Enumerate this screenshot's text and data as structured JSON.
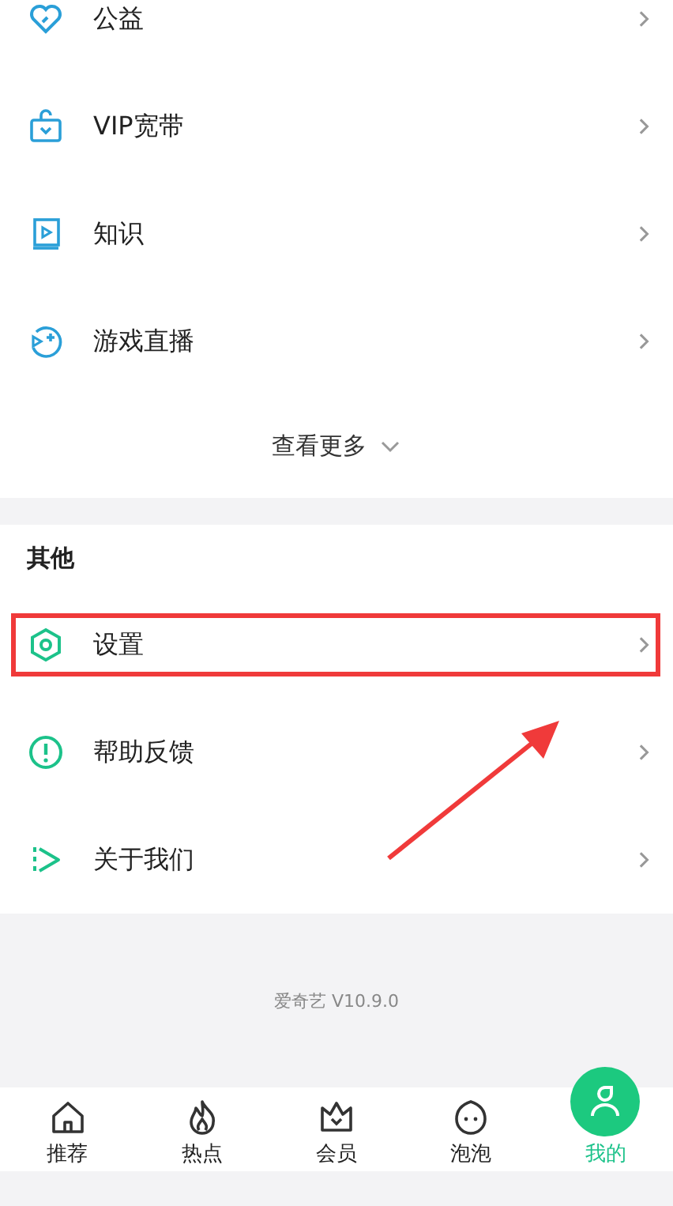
{
  "sections": [
    {
      "items": [
        {
          "label": "公益",
          "kind": "heart",
          "highlighted": false
        },
        {
          "label": "VIP宽带",
          "kind": "tv",
          "highlighted": false
        },
        {
          "label": "知识",
          "kind": "book",
          "highlighted": false
        },
        {
          "label": "游戏直播",
          "kind": "game",
          "highlighted": false
        }
      ],
      "more": "查看更多"
    },
    {
      "title": "其他",
      "items": [
        {
          "label": "设置",
          "kind": "settings",
          "highlighted": true
        },
        {
          "label": "帮助反馈",
          "kind": "help",
          "highlighted": false
        },
        {
          "label": "关于我们",
          "kind": "play",
          "highlighted": false
        }
      ]
    }
  ],
  "annotation": {
    "kind": "arrow"
  },
  "version": "爱奇艺 V10.9.0",
  "tabs": [
    {
      "label": "推荐",
      "kind": "home",
      "selected": false
    },
    {
      "label": "热点",
      "kind": "flame",
      "selected": false
    },
    {
      "label": "会员",
      "kind": "crown",
      "selected": false
    },
    {
      "label": "泡泡",
      "kind": "face",
      "selected": false
    },
    {
      "label": "我的",
      "kind": "person",
      "selected": true
    }
  ]
}
